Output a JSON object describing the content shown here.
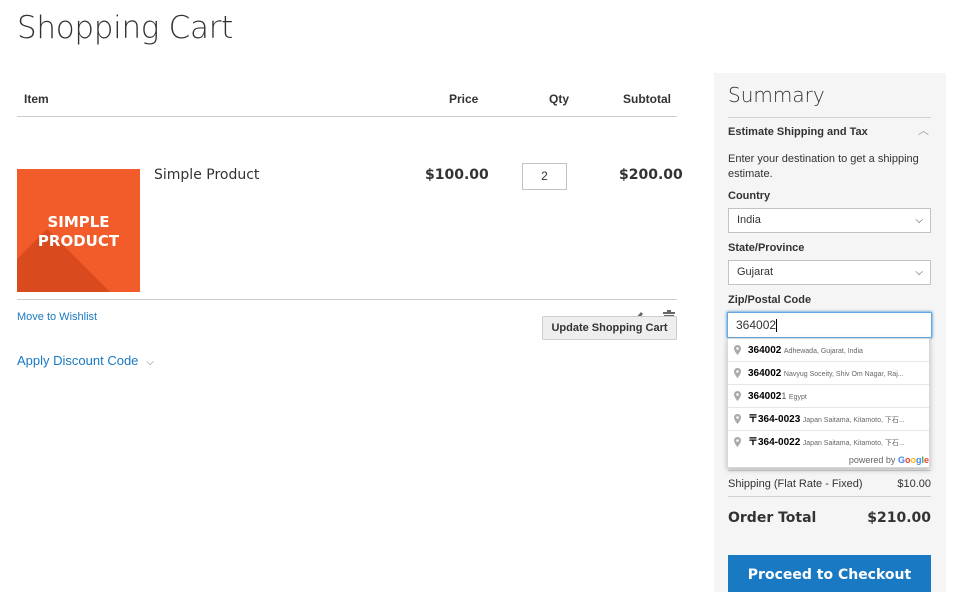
{
  "page": {
    "title": "Shopping Cart"
  },
  "cart": {
    "headers": {
      "item": "Item",
      "price": "Price",
      "qty": "Qty",
      "subtotal": "Subtotal"
    },
    "item": {
      "name": "Simple Product",
      "thumb_line1": "SIMPLE",
      "thumb_line2": "PRODUCT",
      "price": "$100.00",
      "qty": "2",
      "subtotal": "$200.00",
      "wishlist_link": "Move to Wishlist"
    },
    "update_button": "Update Shopping Cart",
    "discount_label": "Apply Discount Code"
  },
  "summary": {
    "title": "Summary",
    "estimate_title": "Estimate Shipping and Tax",
    "estimate_desc": "Enter your destination to get a shipping estimate.",
    "country_label": "Country",
    "country_value": "India",
    "state_label": "State/Province",
    "state_value": "Gujarat",
    "zip_label": "Zip/Postal Code",
    "zip_value": "364002",
    "shipping_label": "Shipping (Flat Rate - Fixed)",
    "shipping_value": "$10.00",
    "total_label": "Order Total",
    "total_value": "$210.00",
    "checkout_button": "Proceed to Checkout"
  },
  "autocomplete": {
    "items": [
      {
        "main": "364002",
        "rest": "",
        "desc": "Adhewada, Gujarat, India"
      },
      {
        "main": "364002",
        "rest": "",
        "desc": "Navyug Soceity, Shiv Om Nagar, Raj..."
      },
      {
        "main": "364002",
        "rest": "1",
        "desc": "Egypt"
      },
      {
        "main": "〒364-0023",
        "rest": "",
        "desc": "Japan Saitama, Kitamoto, 下石..."
      },
      {
        "main": "〒364-0022",
        "rest": "",
        "desc": "Japan Saitama, Kitamoto, 下石..."
      }
    ],
    "powered_by": "powered by",
    "google": "Google"
  },
  "colors": {
    "accent": "#1979c3",
    "thumb": "#f25b2a",
    "summary_bg": "#f5f5f5"
  }
}
